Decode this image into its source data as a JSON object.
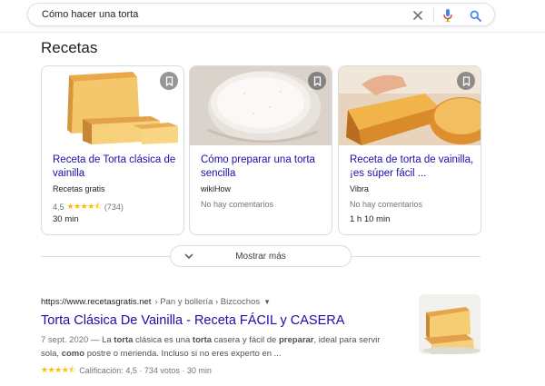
{
  "search": {
    "query": "Cómo hacer una torta",
    "clear_icon": "close-icon",
    "mic_icon": "mic-icon",
    "search_icon": "search-icon"
  },
  "recipes": {
    "heading": "Recetas",
    "cards": [
      {
        "title": "Receta de Torta clásica de vainilla",
        "source": "Recetas gratis",
        "rating": "4,5",
        "rating_value": 4.5,
        "votes": "(734)",
        "time": "30 min"
      },
      {
        "title": "Cómo preparar una torta sencilla",
        "source": "wikiHow",
        "comments": "No hay comentarios"
      },
      {
        "title": "Receta de torta de vainilla, ¡es súper fácil ...",
        "source": "Vibra",
        "comments": "No hay comentarios",
        "time": "1 h 10 min"
      }
    ],
    "show_more": "Mostrar más"
  },
  "result": {
    "domain": "https://www.recetasgratis.net",
    "path": "› Pan y bollería › Bizcochos",
    "title": "Torta Clásica De Vainilla - Receta FÁCIL y CASERA",
    "date": "7 sept. 2020",
    "snippet_parts": [
      " — La ",
      "torta",
      " clásica es una ",
      "torta",
      " casera y fácil de ",
      "preparar",
      ", ideal para servir sola, ",
      "como",
      " postre o merienda. Incluso si no eres experto en ..."
    ],
    "rating_text": "Calificación: 4,5 · 734 votos · 30 min",
    "rating_value": 4.5
  },
  "colors": {
    "link": "#1a0dab",
    "star": "#fbbc04",
    "mic_blue": "#4285f4",
    "mic_red": "#ea4335",
    "search_blue": "#4285f4"
  }
}
